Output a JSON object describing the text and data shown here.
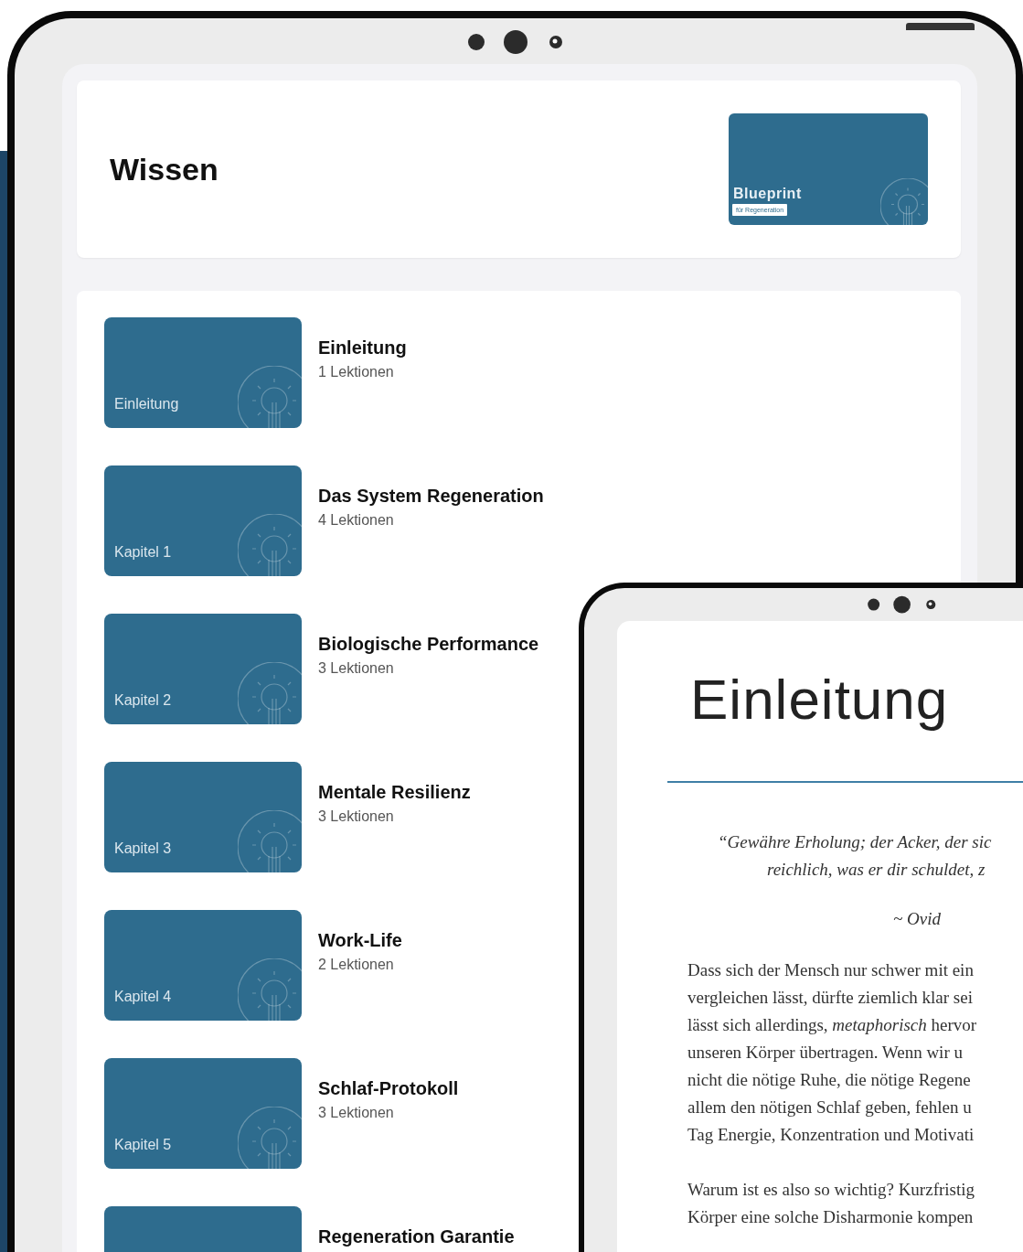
{
  "page": {
    "title": "Wissen"
  },
  "course_cover": {
    "title": "Blueprint",
    "subtitle": "für Regeneration"
  },
  "chapters": [
    {
      "label": "Einleitung",
      "title": "Einleitung",
      "lessons": "1 Lektionen"
    },
    {
      "label": "Kapitel 1",
      "title": "Das System Regeneration",
      "lessons": "4 Lektionen"
    },
    {
      "label": "Kapitel 2",
      "title": "Biologische Performance",
      "lessons": "3 Lektionen"
    },
    {
      "label": "Kapitel 3",
      "title": "Mentale Resilienz",
      "lessons": "3 Lektionen"
    },
    {
      "label": "Kapitel 4",
      "title": "Work-Life",
      "lessons": "2 Lektionen"
    },
    {
      "label": "Kapitel 5",
      "title": "Schlaf-Protokoll",
      "lessons": "3 Lektionen"
    },
    {
      "title": "Regeneration Garantie"
    }
  ],
  "reader": {
    "heading": "Einleitung",
    "quote_lines": [
      "“Gewähre Erholung; der Acker, der sic",
      "reichlich, was er dir schuldet, z"
    ],
    "attribution": "~ Ovid",
    "paragraphs": [
      [
        "Dass sich der Mensch nur schwer mit ein",
        "vergleichen lässt, dürfte ziemlich klar sei",
        "lässt sich allerdings, *metaphorisch* hervor",
        "unseren Körper übertragen. Wenn wir u",
        "nicht die nötige Ruhe, die nötige Regene",
        "allem den nötigen Schlaf geben, fehlen u",
        "Tag Energie, Konzentration und Motivati"
      ],
      [
        "Warum ist es also so wichtig? Kurzfristig",
        "Körper eine solche Disharmonie kompen"
      ]
    ]
  }
}
